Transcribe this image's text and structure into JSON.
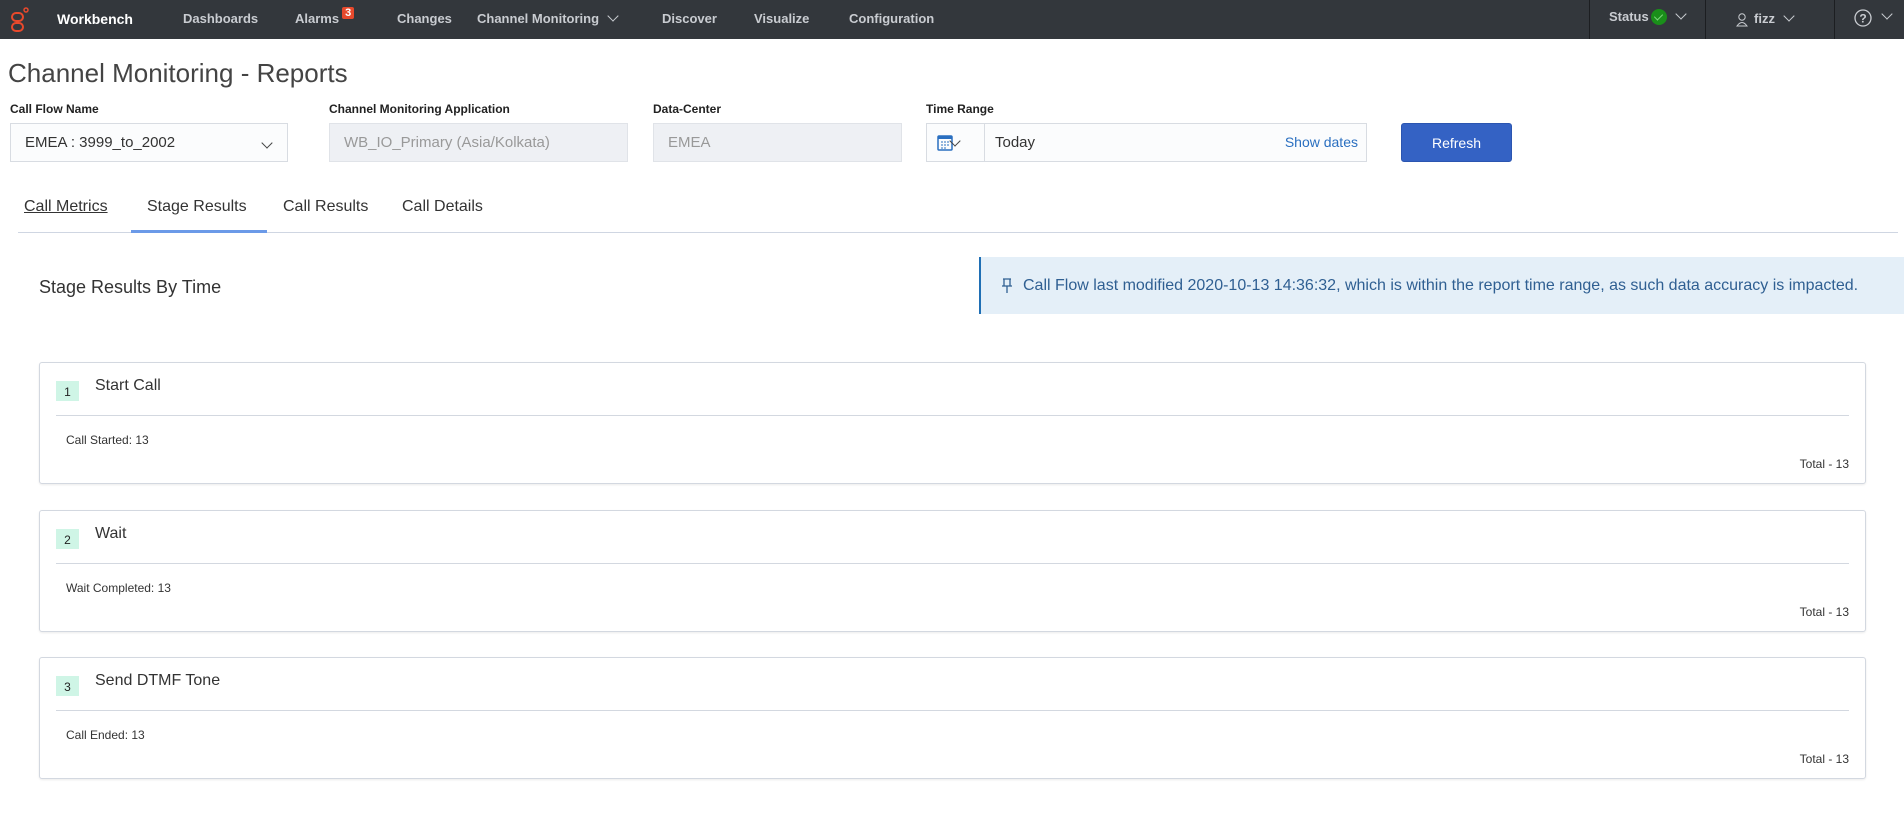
{
  "nav": {
    "brand": "Workbench",
    "items": [
      "Dashboards",
      "Alarms",
      "Changes",
      "Channel Monitoring",
      "Discover",
      "Visualize",
      "Configuration"
    ],
    "alarm_count": "3",
    "status_label": "Status",
    "user": "fizz"
  },
  "page": {
    "title": "Channel Monitoring - Reports"
  },
  "filters": {
    "call_flow": {
      "label": "Call Flow Name",
      "value": "EMEA : 3999_to_2002"
    },
    "app": {
      "label": "Channel Monitoring Application",
      "value": "WB_IO_Primary (Asia/Kolkata)"
    },
    "dc": {
      "label": "Data-Center",
      "value": "EMEA"
    },
    "time": {
      "label": "Time Range",
      "value": "Today",
      "show_dates": "Show dates"
    },
    "refresh": "Refresh"
  },
  "tabs": [
    "Call Metrics",
    "Stage Results",
    "Call Results",
    "Call Details"
  ],
  "section": {
    "title": "Stage Results By Time",
    "banner": "Call Flow last modified 2020-10-13 14:36:32, which is within the report time range, as such data accuracy is impacted."
  },
  "stages": [
    {
      "num": "1",
      "title": "Start Call",
      "detail": "Call Started: 13",
      "total": "Total - 13"
    },
    {
      "num": "2",
      "title": "Wait",
      "detail": "Wait Completed: 13",
      "total": "Total - 13"
    },
    {
      "num": "3",
      "title": "Send DTMF Tone",
      "detail": "Call Ended: 13",
      "total": "Total - 13"
    }
  ]
}
